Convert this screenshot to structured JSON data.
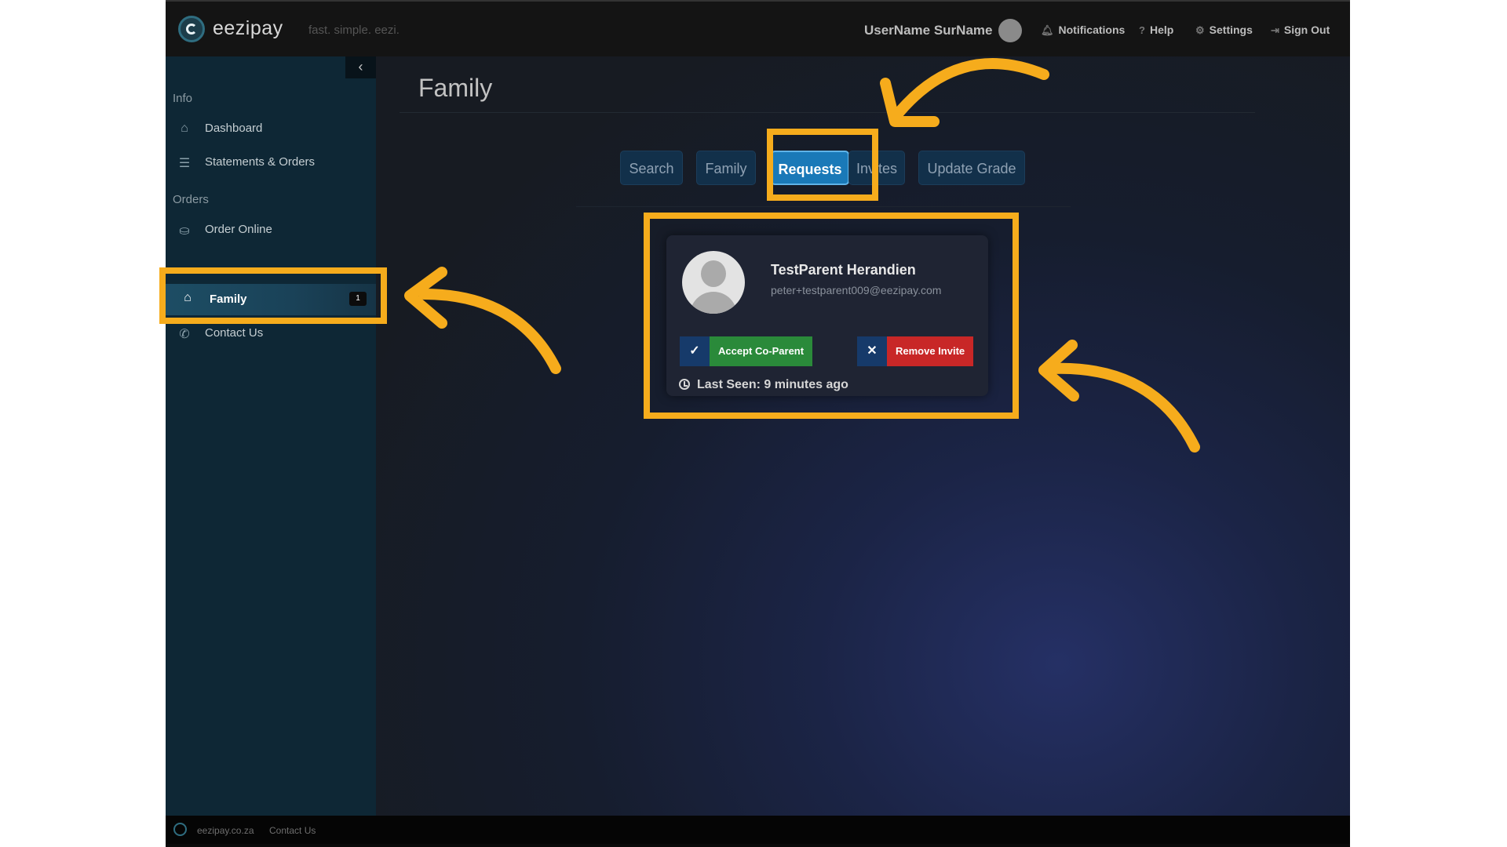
{
  "app": {
    "brand": "eezipay",
    "tagline": "fast. simple. eezi.",
    "user_name": "UserName SurName"
  },
  "topnav": [
    {
      "label": "Notifications",
      "icon": "bell-icon"
    },
    {
      "label": "Help",
      "icon": "question-icon"
    },
    {
      "label": "Settings",
      "icon": "gear-icon"
    },
    {
      "label": "Sign Out",
      "icon": "sign-out-icon"
    }
  ],
  "sidebar": {
    "collapse_glyph": "‹",
    "sections": [
      "Info",
      "Orders"
    ],
    "items": [
      {
        "label": "Dashboard",
        "icon": "home-icon"
      },
      {
        "label": "Statements & Orders",
        "icon": "list-icon"
      },
      {
        "label": "Order Online",
        "icon": "basket-icon"
      },
      {
        "label": "Family",
        "icon": "family-icon",
        "badge": "1",
        "active": true
      },
      {
        "label": "Contact Us",
        "icon": "phone-icon"
      }
    ]
  },
  "main": {
    "title": "Family",
    "tabs": [
      {
        "label": "Search"
      },
      {
        "label": "Family"
      },
      {
        "label": "Requests",
        "active": true
      },
      {
        "label": "Invites"
      },
      {
        "label": "Update Grade"
      }
    ],
    "request_card": {
      "name": "TestParent Herandien",
      "email": "peter+testparent009@eezipay.com",
      "accept_label": "Accept Co-Parent",
      "remove_label": "Remove Invite",
      "last_seen": "Last Seen: 9 minutes ago"
    }
  },
  "footer": {
    "site": "eezipay.co.za",
    "contact": "Contact Us"
  },
  "colors": {
    "highlight": "#f6ac1c",
    "accept": "#2a8a3a",
    "remove": "#c82727",
    "active_tab": "#1a79b8",
    "sidebar": "#0e2735"
  }
}
